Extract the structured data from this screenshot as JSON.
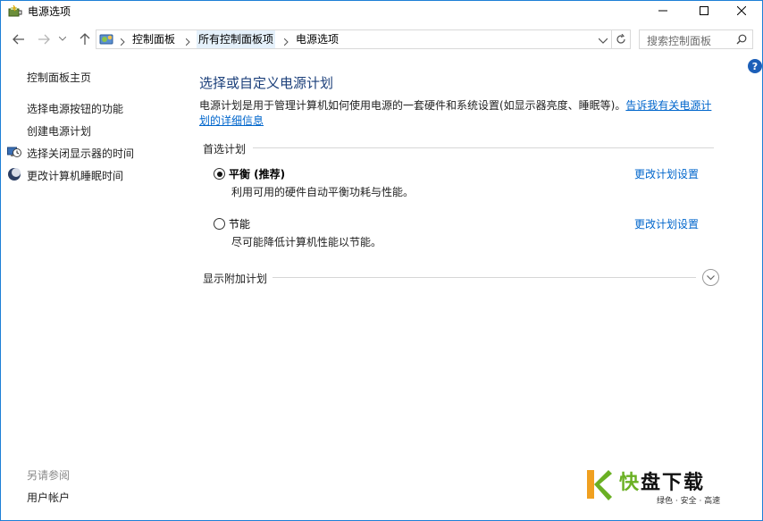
{
  "window": {
    "title": "电源选项",
    "minimize_glyph": "—",
    "maximize_glyph": "☐",
    "close_glyph": "✕"
  },
  "nav": {
    "back": "←",
    "forward": "→",
    "recent": "˅",
    "up": "↑",
    "refresh": "↻",
    "breadcrumb": [
      "控制面板",
      "所有控制面板项",
      "电源选项"
    ],
    "breadcrumb_sep": "›",
    "search_placeholder": "搜索控制面板"
  },
  "help": {
    "glyph": "?"
  },
  "sidebar": {
    "home": "控制面板主页",
    "items": [
      {
        "label": "选择电源按钮的功能",
        "icon": "none"
      },
      {
        "label": "创建电源计划",
        "icon": "none"
      },
      {
        "label": "选择关闭显示器的时间",
        "icon": "monitor-clock-icon"
      },
      {
        "label": "更改计算机睡眠时间",
        "icon": "moon-icon"
      }
    ],
    "see_also": "另请参阅",
    "user_accounts": "用户帐户"
  },
  "main": {
    "title": "选择或自定义电源计划",
    "description": "电源计划是用于管理计算机如何使用电源的一套硬件和系统设置(如显示器亮度、睡眠等)。",
    "description_link_1": "告诉我有关电源计",
    "description_link_2": "划的详细信息",
    "preferred_label": "首选计划",
    "plans": [
      {
        "name": "平衡 (推荐)",
        "desc": "利用可用的硬件自动平衡功耗与性能。",
        "selected": true,
        "link": "更改计划设置"
      },
      {
        "name": "节能",
        "desc": "尽可能降低计算机性能以节能。",
        "selected": false,
        "link": "更改计划设置"
      }
    ],
    "additional_label": "显示附加计划"
  },
  "watermark": {
    "title_a": "快",
    "title_b": "盘下载",
    "subtitle": "绿色 · 安全 · 高速"
  },
  "colors": {
    "link": "#0066cc",
    "title": "#1b3f7a",
    "accent_border": "#1e7fd6",
    "watermark_green": "#6ab023"
  }
}
